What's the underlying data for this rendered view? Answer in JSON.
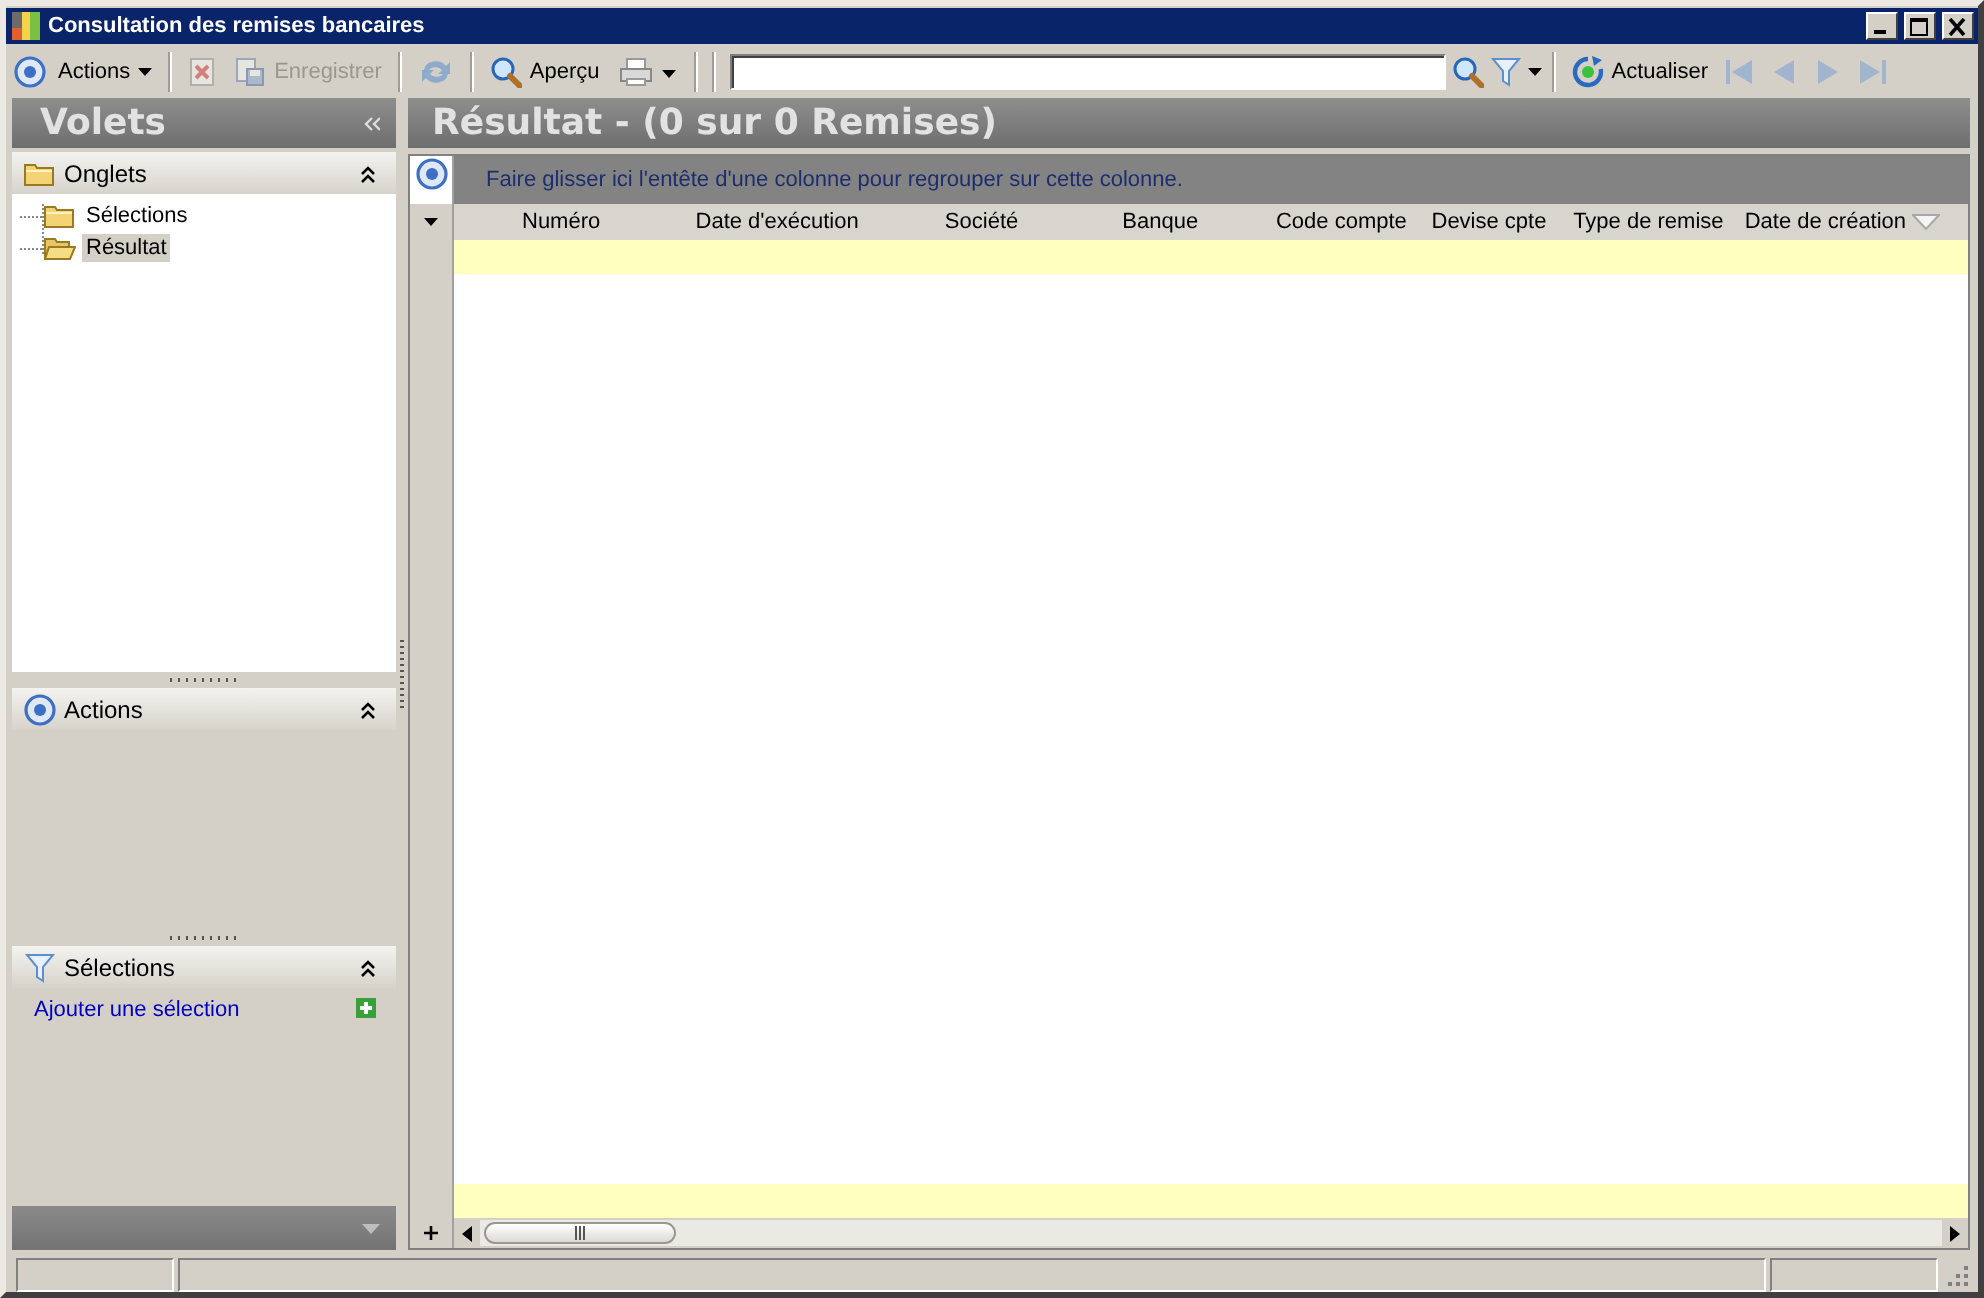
{
  "window": {
    "title": "Consultation des remises bancaires"
  },
  "toolbar": {
    "actions_menu": {
      "label": "Actions"
    },
    "delete_button": {
      "disabled": true
    },
    "save_button": {
      "label": "Enregistrer",
      "disabled": true
    },
    "sync_button": {
      "disabled": true
    },
    "preview_button": {
      "label": "Aperçu",
      "disabled": false
    },
    "print_button": {
      "disabled": false
    },
    "refresh_button": {
      "label": "Actualiser",
      "disabled": false
    },
    "navigation": [
      {
        "kind": "first",
        "disabled": true
      },
      {
        "kind": "previous",
        "disabled": true
      },
      {
        "kind": "next",
        "disabled": true
      },
      {
        "kind": "last",
        "disabled": true
      }
    ]
  },
  "side_panel": {
    "title": "Volets",
    "sections": [
      {
        "kind": "tree",
        "title": "Onglets",
        "expanded": true,
        "items": [
          {
            "label": "Sélections",
            "selected": false
          },
          {
            "label": "Résultat",
            "selected": true
          }
        ]
      },
      {
        "kind": "actions",
        "title": "Actions",
        "expanded": true
      },
      {
        "kind": "selections",
        "title": "Sélections",
        "expanded": true,
        "link": "Ajouter une sélection"
      }
    ]
  },
  "result": {
    "title": "Résultat - (0 sur 0 Remises)",
    "group_hint": "Faire glisser ici l'entête d'une colonne pour regrouper sur cette colonne.",
    "columns": [
      {
        "label": "Numéro",
        "filter": false
      },
      {
        "label": "Date d'exécution",
        "filter": false
      },
      {
        "label": "Société",
        "filter": false
      },
      {
        "label": "Banque",
        "filter": false
      },
      {
        "label": "Code compte",
        "filter": false
      },
      {
        "label": "Devise cpte",
        "filter": false
      },
      {
        "label": "Type de remise",
        "filter": false
      },
      {
        "label": "Date de création",
        "filter": true
      }
    ]
  }
}
